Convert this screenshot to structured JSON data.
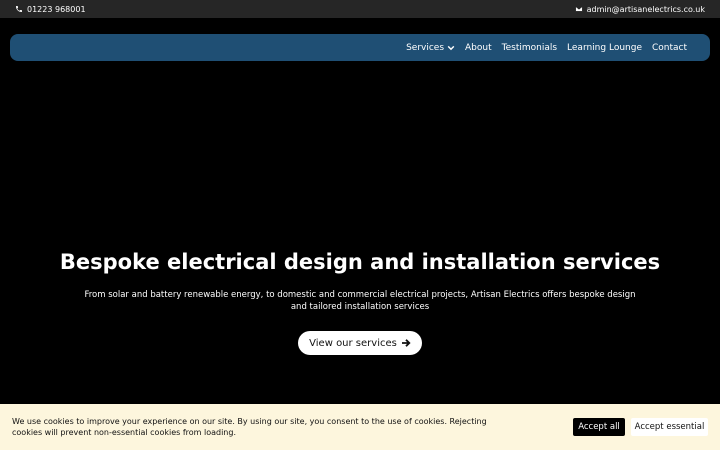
{
  "topbar": {
    "phone": "01223 968001",
    "email": "admin@artisanelectrics.co.uk"
  },
  "nav": {
    "items": [
      "Services",
      "About",
      "Testimonials",
      "Learning Lounge",
      "Contact"
    ]
  },
  "hero": {
    "title": "Bespoke electrical design and installation services",
    "subtitle": "From solar and battery renewable energy, to domestic and commercial electrical projects, Artisan Electrics offers bespoke design and tailored installation services",
    "cta_label": "View our services"
  },
  "cookie": {
    "text": "We use cookies to improve your experience on our site. By using our site, you consent to the use of cookies. Rejecting cookies will prevent non-essential cookies from loading.",
    "accept_all": "Accept all",
    "accept_essential": "Accept essential"
  },
  "colors": {
    "topbar": "#262626",
    "nav": "#1f4f74",
    "hero_bg": "#000000",
    "cookie_bg": "#fdf6dd"
  }
}
